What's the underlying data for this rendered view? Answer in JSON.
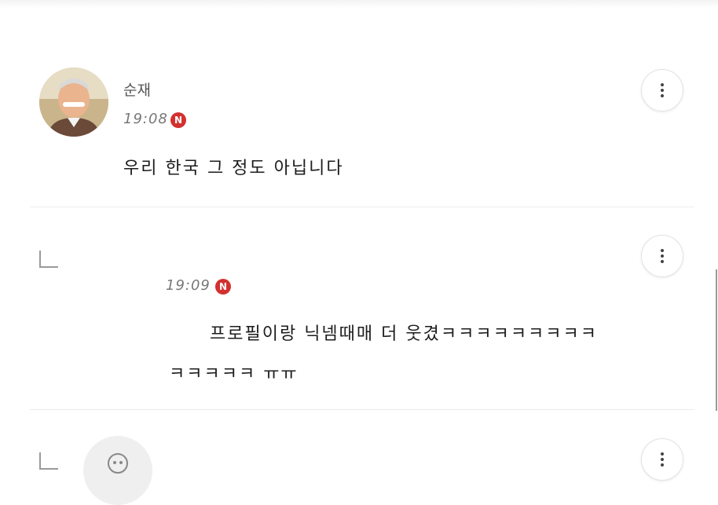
{
  "comments": [
    {
      "author": "순재",
      "time": "19:08",
      "badge": "N",
      "text": "우리 한국 그 정도 아닙니다"
    },
    {
      "time": "19:09",
      "badge": "N",
      "text_line1": "프로필이랑 닉넴때매 더 웃겼ㅋㅋㅋㅋㅋㅋㅋㅋㅋ",
      "text_line2": "ㅋㅋㅋㅋㅋ ㅠㅠ"
    }
  ],
  "icons": {
    "more": "more-vertical-icon",
    "reply": "reply-arrow-icon",
    "new_badge": "new-badge-icon"
  },
  "colors": {
    "badge": "#d2312f",
    "divider": "#ececec"
  }
}
